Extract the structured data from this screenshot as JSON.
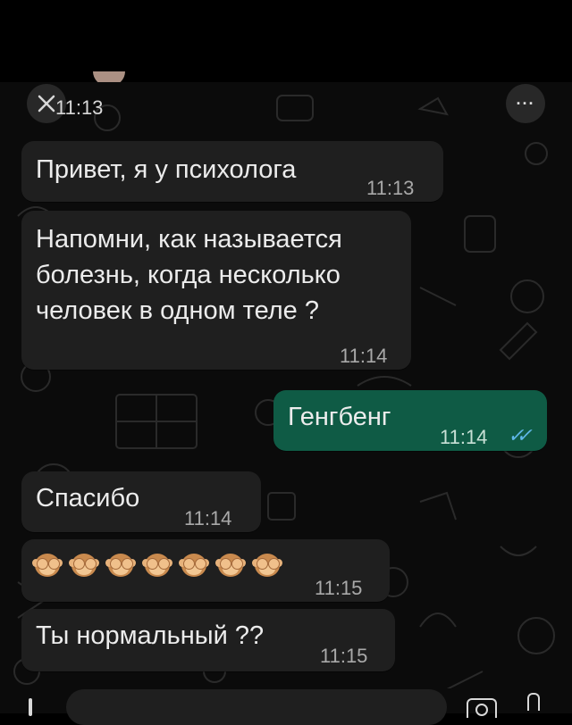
{
  "header": {
    "time_top": "11:13",
    "more_label": "···"
  },
  "messages": [
    {
      "direction": "in",
      "text": "Привет, я у психолога",
      "time": "11:13"
    },
    {
      "direction": "in",
      "text": "Напомни, как называется\nболезнь, когда несколько\nчеловек в одном теле ?",
      "time": "11:14"
    },
    {
      "direction": "out",
      "text": "Генгбенг",
      "time": "11:14",
      "status": "read"
    },
    {
      "direction": "in",
      "text": "Спасибо",
      "time": "11:14"
    },
    {
      "direction": "in",
      "emoji": "see-no-evil-monkey",
      "emoji_count": 7,
      "time": "11:15"
    },
    {
      "direction": "in",
      "text": "Ты нормальный ??",
      "time": "11:15"
    }
  ],
  "icons": {
    "close": "close-icon",
    "more": "more-icon",
    "read_ticks": "double-check-icon",
    "attach": "plus-icon",
    "camera": "camera-icon",
    "mic": "mic-icon"
  },
  "colors": {
    "background": "#0b0b0b",
    "incoming_bubble": "#1f1f1f",
    "outgoing_bubble": "#0f5b45",
    "read_ticks": "#5fb7e8"
  }
}
